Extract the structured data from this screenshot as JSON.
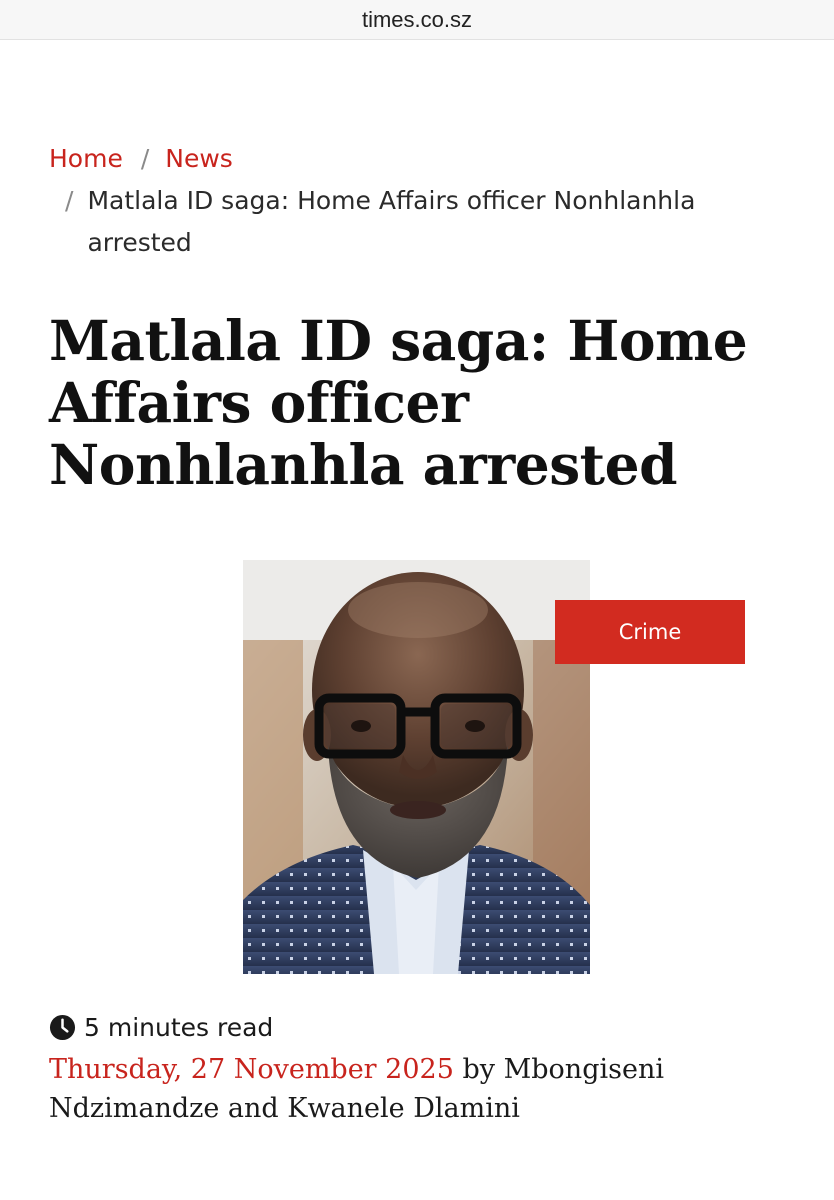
{
  "browser": {
    "url": "times.co.sz"
  },
  "breadcrumb": {
    "home": "Home",
    "news": "News",
    "separator": "/",
    "current": "Matlala ID saga: Home Affairs officer Nonhlanhla arrested"
  },
  "article": {
    "headline": "Matlala ID saga: Home Affairs officer Nonhlanhla arrested",
    "category": "Crime",
    "read_time": "5 minutes read",
    "date": "Thursday, 27 November 2025",
    "by_word": "by",
    "authors": "Mbongiseni Ndzimandze and Kwanele Dlamini"
  },
  "colors": {
    "accent": "#c8241d",
    "badge": "#d22b20",
    "text": "#111111"
  },
  "icons": {
    "read_time": "clock-icon"
  }
}
